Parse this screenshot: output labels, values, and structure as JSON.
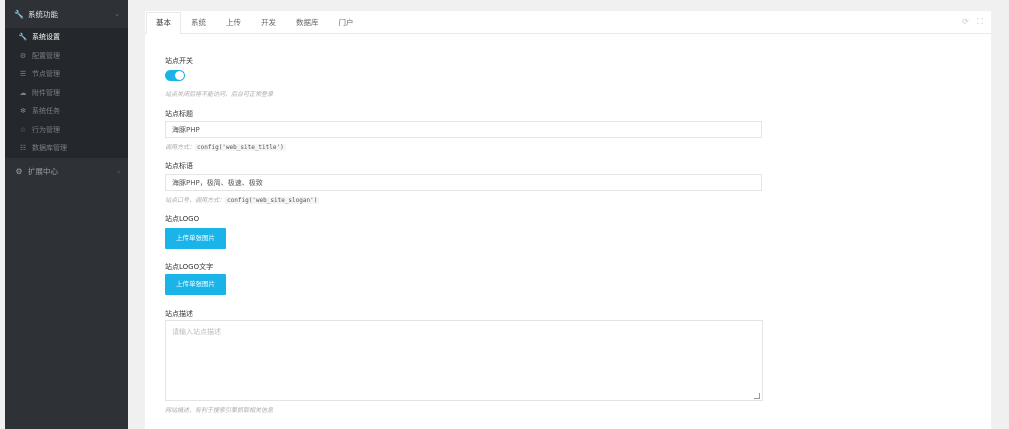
{
  "sidebar": {
    "group1": {
      "label": "系统功能",
      "icon": "wrench-icon"
    },
    "items": [
      {
        "label": "系统设置",
        "icon": "wrench-icon",
        "active": true
      },
      {
        "label": "配置管理",
        "icon": "gear-icon"
      },
      {
        "label": "节点管理",
        "icon": "list-icon"
      },
      {
        "label": "附件管理",
        "icon": "cloud-icon"
      },
      {
        "label": "系统任务",
        "icon": "sliders-icon"
      },
      {
        "label": "行为管理",
        "icon": "star-icon"
      },
      {
        "label": "数据库管理",
        "icon": "database-icon"
      }
    ],
    "group2": {
      "label": "扩展中心",
      "icon": "puzzle-icon"
    }
  },
  "tabs": [
    {
      "label": "基本",
      "active": true
    },
    {
      "label": "系统"
    },
    {
      "label": "上传"
    },
    {
      "label": "开发"
    },
    {
      "label": "数据库"
    },
    {
      "label": "门户"
    }
  ],
  "form": {
    "site_switch": {
      "label": "站点开关",
      "value": true,
      "help": "站点关闭后将不能访问，后台可正常登录"
    },
    "site_title": {
      "label": "站点标题",
      "value": "海豚PHP",
      "help_prefix": "调用方式：",
      "help_code": "config('web_site_title')"
    },
    "site_slogan": {
      "label": "站点标语",
      "value": "海豚PHP，极简、极速、极致",
      "help_prefix": "站点口号，调用方式：",
      "help_code": "config('web_site_slogan')"
    },
    "site_logo": {
      "label": "站点LOGO",
      "button": "上传单张图片"
    },
    "site_logo_text": {
      "label": "站点LOGO文字",
      "button": "上传单张图片"
    },
    "site_description": {
      "label": "站点描述",
      "placeholder": "请输入站点描述",
      "help": "网站描述，有利于搜索引擎抓取相关信息"
    }
  }
}
